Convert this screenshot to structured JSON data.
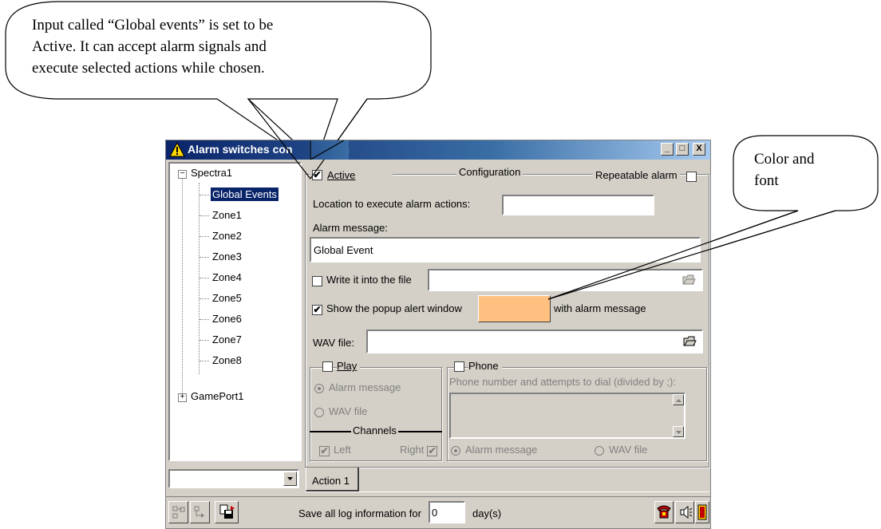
{
  "callouts": {
    "top": {
      "lines": [
        "Input called “Global events” is set to be",
        "Active. It can accept alarm signals and",
        "execute selected actions while chosen."
      ]
    },
    "right": {
      "lines": [
        "Color and",
        "font"
      ]
    }
  },
  "window": {
    "title": "Alarm switches configuration",
    "title_visible": "Alarm switches con",
    "title_tail": "ation",
    "controls": {
      "minimize": "_",
      "maximize": "□",
      "close": "X"
    }
  },
  "tree": {
    "items": [
      {
        "label": "Spectra1",
        "expander": "−",
        "level": 0
      },
      {
        "label": "Global Events",
        "selected": true,
        "level": 1
      },
      {
        "label": "Zone1",
        "level": 1
      },
      {
        "label": "Zone2",
        "level": 1
      },
      {
        "label": "Zone3",
        "level": 1
      },
      {
        "label": "Zone4",
        "level": 1
      },
      {
        "label": "Zone5",
        "level": 1
      },
      {
        "label": "Zone6",
        "level": 1
      },
      {
        "label": "Zone7",
        "level": 1
      },
      {
        "label": "Zone8",
        "level": 1
      },
      {
        "label": "GamePort1",
        "expander": "+",
        "level": 0
      }
    ],
    "combo_value": ""
  },
  "config": {
    "active_label": "Active",
    "active_checked": true,
    "group_title": "Configuration",
    "repeatable_label": "Repeatable alarm",
    "repeatable_checked": false,
    "location_label": "Location to execute alarm actions:",
    "location_value": "",
    "alarm_message_label": "Alarm message:",
    "alarm_message_value": "Global Event",
    "write_file_label": "Write it into the file",
    "write_file_checked": false,
    "write_file_value": "",
    "show_popup_label": "Show the popup alert window",
    "show_popup_checked": true,
    "popup_color": "#ffc080",
    "with_alarm_label": "with alarm message",
    "wav_label": "WAV file:",
    "wav_value": ""
  },
  "play": {
    "label": "Play",
    "checked": false,
    "alarm_message": "Alarm message",
    "wav_file": "WAV file",
    "channels": "Channels",
    "left": "Left",
    "right": "Right"
  },
  "phone": {
    "label": "Phone",
    "checked": false,
    "numbers_label": "Phone number and attempts to dial (divided by ;):",
    "alarm_message": "Alarm message",
    "wav_file": "WAV file"
  },
  "tabs": [
    "Action 1"
  ],
  "footer": {
    "save_prefix": "Save all log information for",
    "days_value": "0",
    "days_suffix": "day(s)"
  },
  "colors": {
    "titlebar": "#0a246a",
    "face": "#d4d0c8",
    "selection": "#0a246a",
    "popup_color": "#ffc080"
  }
}
